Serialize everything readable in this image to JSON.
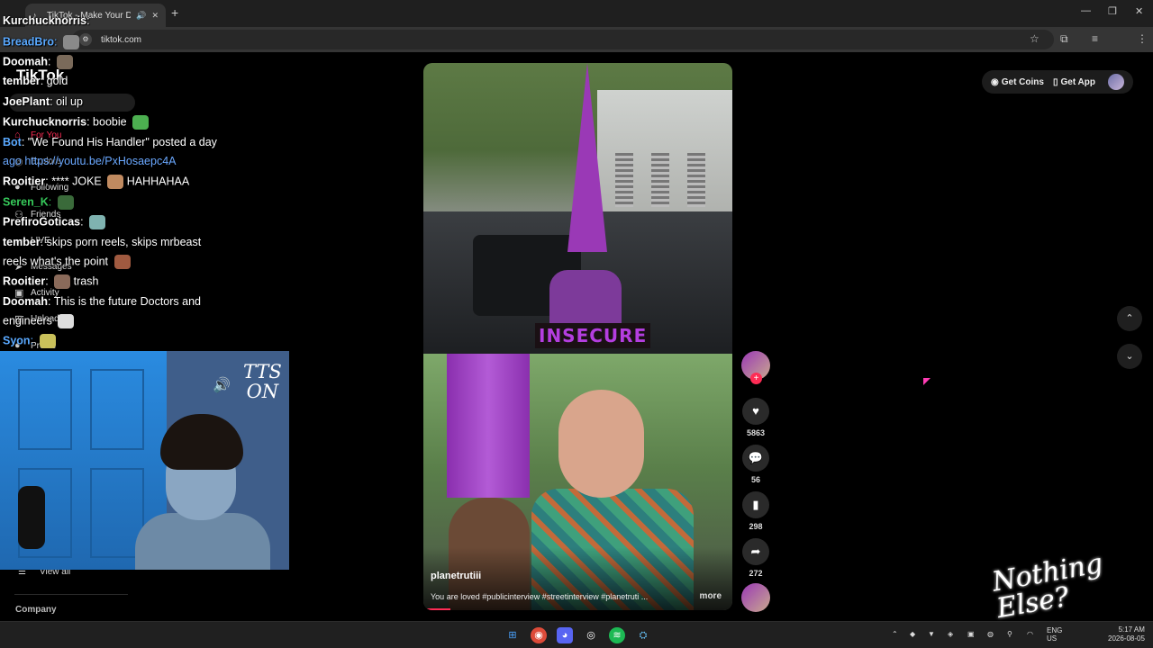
{
  "browser": {
    "tab_title": "TikTok - Make Your Day",
    "tab_audio_icon": "speaker-icon",
    "tab_close": "✕",
    "new_tab": "+",
    "url": "tiktok.com",
    "window_controls": [
      "—",
      "❐",
      "✕"
    ]
  },
  "tiktok": {
    "logo": "TikTok",
    "nav": [
      {
        "label": "For You",
        "icon": "home-icon",
        "active": true
      },
      {
        "label": "Explore",
        "icon": "compass-icon",
        "active": false
      },
      {
        "label": "Following",
        "icon": "following-icon",
        "active": false
      },
      {
        "label": "Friends",
        "icon": "friends-icon",
        "active": false
      },
      {
        "label": "LIVE",
        "icon": "live-icon",
        "active": false
      },
      {
        "label": "Messages",
        "icon": "messages-icon",
        "active": false
      },
      {
        "label": "Activity",
        "icon": "activity-icon",
        "active": false
      },
      {
        "label": "Upload",
        "icon": "upload-icon",
        "active": false
      },
      {
        "label": "Profile",
        "icon": "profile-icon",
        "active": false
      }
    ],
    "view_all": "View all",
    "company": "Company",
    "get_coins": "Get Coins",
    "get_app": "Get App",
    "video": {
      "caption_overlay": "INSECURE",
      "author": "planetrutiii",
      "description": "You are loved #publicinterview #streetinterview #planetruti ...",
      "more": "more"
    },
    "actions": {
      "likes": "5863",
      "comments": "56",
      "saves": "298",
      "shares": "272"
    },
    "accent": "#fe2c55"
  },
  "chat": [
    {
      "user": "Kurchucknorris",
      "text": "",
      "color": "#ffffff"
    },
    {
      "user": "BreadBro",
      "text": "",
      "color": "#5aa9ff"
    },
    {
      "user": "Doomah",
      "text": "",
      "color": "#ffffff"
    },
    {
      "user": "tember",
      "text": "gold",
      "color": "#ffffff"
    },
    {
      "user": "JoePlant",
      "text": "oil up",
      "color": "#ffffff"
    },
    {
      "user": "Kurchucknorris",
      "text": "boobie",
      "color": "#ffffff"
    },
    {
      "user": "Bot",
      "text": "\"We Found His Handler\" posted a day",
      "color": "#5aa9ff"
    },
    {
      "user": "",
      "text": "ago https://youtu.be/PxHosaepc4A",
      "color": "#ffffff"
    },
    {
      "user": "Rooitier",
      "text": "**** JOKE",
      "text2": "HAHHAHAA",
      "color": "#ffffff"
    },
    {
      "user": "Seren_K",
      "text": "",
      "color": "#36c95a"
    },
    {
      "user": "PrefiroGoticas",
      "text": "",
      "color": "#ffffff"
    },
    {
      "user": "tember",
      "text": "skips porn reels, skips mrbeast",
      "color": "#ffffff"
    },
    {
      "user": "",
      "text": "reels what's the point",
      "color": "#ffffff"
    },
    {
      "user": "Rooitier",
      "text": "trash",
      "color": "#ffffff"
    },
    {
      "user": "Doomah",
      "text": "This is the future Doctors and",
      "color": "#ffffff"
    },
    {
      "user": "",
      "text": "engineers",
      "color": "#ffffff"
    },
    {
      "user": "Syon",
      "text": "",
      "color": "#5aa9ff"
    }
  ],
  "webcam": {
    "tts_line1": "TTS",
    "tts_line2": "ON"
  },
  "brand_text": "Nothing Else?",
  "taskbar": {
    "lang": "ENG",
    "region": "US",
    "time": "5:17 AM",
    "date": "2026-08-05"
  }
}
